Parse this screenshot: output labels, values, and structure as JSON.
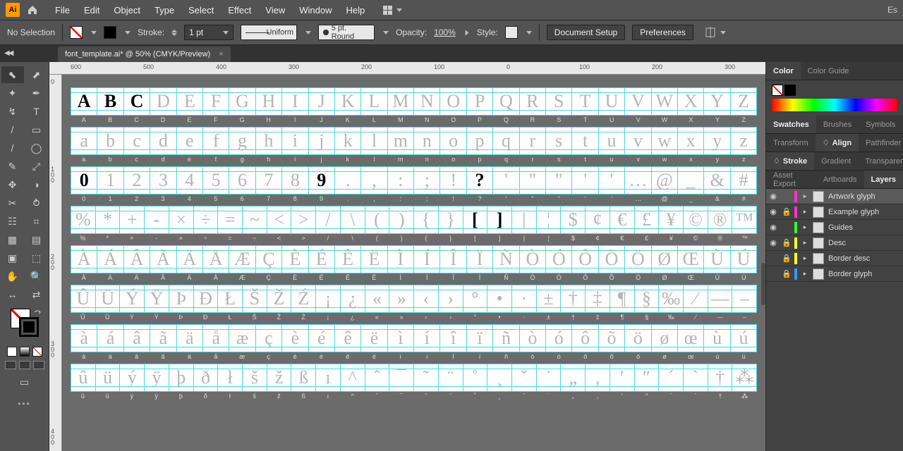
{
  "menubar": {
    "app": "Ai",
    "items": [
      "File",
      "Edit",
      "Object",
      "Type",
      "Select",
      "Effect",
      "View",
      "Window",
      "Help"
    ],
    "right": "Es"
  },
  "control": {
    "selection": "No Selection",
    "stroke_label": "Stroke:",
    "stroke_weight": "1 pt",
    "profile": "Uniform",
    "brush": "5 pt. Round",
    "opacity_label": "Opacity:",
    "opacity": "100%",
    "style_label": "Style:",
    "doc_setup": "Document Setup",
    "prefs": "Preferences"
  },
  "tab": {
    "title": "font_template.ai* @ 50% (CMYK/Preview)"
  },
  "ruler_h": [
    "600",
    "500",
    "400",
    "300",
    "200",
    "100",
    "0",
    "100",
    "200",
    "300"
  ],
  "ruler_v": [
    "0",
    "100",
    "200",
    "300",
    "400"
  ],
  "panels": {
    "color": "Color",
    "colorguide": "Color Guide",
    "swatches": "Swatches",
    "brushes": "Brushes",
    "symbols": "Symbols",
    "transform": "Transform",
    "align": "Align",
    "pathfinder": "Pathfinder",
    "stroke": "Stroke",
    "gradient": "Gradient",
    "transparency": "Transparency",
    "assetexport": "Asset Export",
    "artboards": "Artboards",
    "layers": "Layers"
  },
  "layers": [
    {
      "vis": "●",
      "lock": "",
      "color": "#ff33cc",
      "name": "Artwork glyph",
      "sel": true
    },
    {
      "vis": "●",
      "lock": "🔒",
      "color": "#ff33cc",
      "name": "Example glyph"
    },
    {
      "vis": "●",
      "lock": "",
      "color": "#33ff33",
      "name": "Guides"
    },
    {
      "vis": "●",
      "lock": "🔒",
      "color": "#ffff33",
      "name": "Desc"
    },
    {
      "vis": "",
      "lock": "🔒",
      "color": "#ffff33",
      "name": "Border desc"
    },
    {
      "vis": "",
      "lock": "🔒",
      "color": "#3399ff",
      "name": "Border glyph"
    }
  ],
  "glyph_rows": [
    {
      "drawn": [
        0,
        1,
        2
      ],
      "cells": [
        "A",
        "B",
        "C",
        "D",
        "E",
        "F",
        "G",
        "H",
        "I",
        "J",
        "K",
        "L",
        "M",
        "N",
        "O",
        "P",
        "Q",
        "R",
        "S",
        "T",
        "U",
        "V",
        "W",
        "X",
        "Y",
        "Z"
      ],
      "labels": [
        "A",
        "B",
        "C",
        "D",
        "E",
        "F",
        "G",
        "H",
        "I",
        "J",
        "K",
        "L",
        "M",
        "N",
        "O",
        "P",
        "Q",
        "R",
        "S",
        "T",
        "U",
        "V",
        "W",
        "X",
        "Y",
        "Z"
      ]
    },
    {
      "drawn": [],
      "cells": [
        "a",
        "b",
        "c",
        "d",
        "e",
        "f",
        "g",
        "h",
        "i",
        "j",
        "k",
        "l",
        "m",
        "n",
        "o",
        "p",
        "q",
        "r",
        "s",
        "t",
        "u",
        "v",
        "w",
        "x",
        "y",
        "z"
      ],
      "labels": [
        "a",
        "b",
        "c",
        "d",
        "e",
        "f",
        "g",
        "h",
        "i",
        "j",
        "k",
        "l",
        "m",
        "n",
        "o",
        "p",
        "q",
        "r",
        "s",
        "t",
        "u",
        "v",
        "w",
        "x",
        "y",
        "z"
      ]
    },
    {
      "drawn": [
        0,
        9,
        15
      ],
      "cells": [
        "0",
        "1",
        "2",
        "3",
        "4",
        "5",
        "6",
        "7",
        "8",
        "9",
        ".",
        ",",
        ":",
        ";",
        "!",
        "?",
        "'",
        "\"",
        "\"",
        "'",
        "'",
        "…",
        "@",
        "_",
        "&",
        "#"
      ],
      "labels": [
        "0",
        "1",
        "2",
        "3",
        "4",
        "5",
        "6",
        "7",
        "8",
        "9",
        ".",
        ",",
        ":",
        ";",
        "!",
        "?",
        "'",
        "\"",
        "\"",
        "'",
        "'",
        "…",
        "@",
        "_",
        "&",
        "#"
      ]
    },
    {
      "drawn": [
        16,
        17
      ],
      "cells": [
        "%",
        "*",
        "+",
        "-",
        "×",
        "÷",
        "=",
        "~",
        "<",
        ">",
        "/",
        "\\",
        "(",
        ")",
        "{",
        "}",
        "[",
        "]",
        "|",
        "¦",
        "$",
        "¢",
        "€",
        "£",
        "¥",
        "©",
        "®",
        "™"
      ],
      "labels": [
        "%",
        "*",
        "+",
        "-",
        "×",
        "÷",
        "=",
        "~",
        "<",
        ">",
        "/",
        "\\",
        "(",
        ")",
        "{",
        "}",
        "[",
        "]",
        "|",
        "¦",
        "$",
        "¢",
        "€",
        "£",
        "¥",
        "©",
        "®",
        "™"
      ]
    },
    {
      "drawn": [],
      "cells": [
        "À",
        "Á",
        "Â",
        "Ã",
        "Ä",
        "Å",
        "Æ",
        "Ç",
        "È",
        "É",
        "Ê",
        "Ë",
        "Ì",
        "Í",
        "Î",
        "Ï",
        "Ñ",
        "Ò",
        "Ó",
        "Ô",
        "Õ",
        "Ö",
        "Ø",
        "Œ",
        "Ù",
        "Ú"
      ],
      "labels": [
        "À",
        "Á",
        "Â",
        "Ã",
        "Ä",
        "Å",
        "Æ",
        "Ç",
        "È",
        "É",
        "Ê",
        "Ë",
        "Ì",
        "Í",
        "Î",
        "Ï",
        "Ñ",
        "Ò",
        "Ó",
        "Ô",
        "Õ",
        "Ö",
        "Ø",
        "Œ",
        "Ù",
        "Ú"
      ]
    },
    {
      "drawn": [],
      "cells": [
        "Û",
        "Ü",
        "Ý",
        "Ÿ",
        "Þ",
        "Ð",
        "Ł",
        "Š",
        "Ž",
        "Ź",
        "¡",
        "¿",
        "«",
        "»",
        "‹",
        "›",
        "°",
        "•",
        "·",
        "±",
        "†",
        "‡",
        "¶",
        "§",
        "‰",
        "⁄",
        "—",
        "–"
      ],
      "labels": [
        "Û",
        "Ü",
        "Ý",
        "Ÿ",
        "Þ",
        "Ð",
        "Ł",
        "Š",
        "Ž",
        "Ź",
        "¡",
        "¿",
        "«",
        "»",
        "‹",
        "›",
        "°",
        "•",
        "·",
        "±",
        "†",
        "‡",
        "¶",
        "§",
        "‰",
        "⁄",
        "—",
        "–"
      ]
    },
    {
      "drawn": [],
      "cells": [
        "à",
        "á",
        "â",
        "ã",
        "ä",
        "å",
        "æ",
        "ç",
        "è",
        "é",
        "ê",
        "ë",
        "ì",
        "í",
        "î",
        "ï",
        "ñ",
        "ò",
        "ó",
        "ô",
        "õ",
        "ö",
        "ø",
        "œ",
        "ù",
        "ú"
      ],
      "labels": [
        "à",
        "á",
        "â",
        "ã",
        "ä",
        "å",
        "æ",
        "ç",
        "è",
        "é",
        "ê",
        "ë",
        "ì",
        "í",
        "î",
        "ï",
        "ñ",
        "ò",
        "ó",
        "ô",
        "õ",
        "ö",
        "ø",
        "œ",
        "ù",
        "ú"
      ]
    },
    {
      "drawn": [],
      "cells": [
        "û",
        "ü",
        "ý",
        "ÿ",
        "þ",
        "ð",
        "ł",
        "š",
        "ž",
        "ß",
        "ı",
        "^",
        "ˆ",
        "¯",
        "˜",
        "¨",
        "˚",
        "¸",
        "ˇ",
        "˙",
        "„",
        "‚",
        "′",
        "″",
        "´",
        "`",
        "†",
        "⁂"
      ],
      "labels": [
        "û",
        "ü",
        "ý",
        "ÿ",
        "þ",
        "ð",
        "ł",
        "š",
        "ž",
        "ß",
        "ı",
        "^",
        "ˆ",
        "¯",
        "˜",
        "¨",
        "˚",
        "¸",
        "ˇ",
        "˙",
        "„",
        "‚",
        "′",
        "″",
        "´",
        "`",
        "†",
        "⁂"
      ]
    }
  ]
}
